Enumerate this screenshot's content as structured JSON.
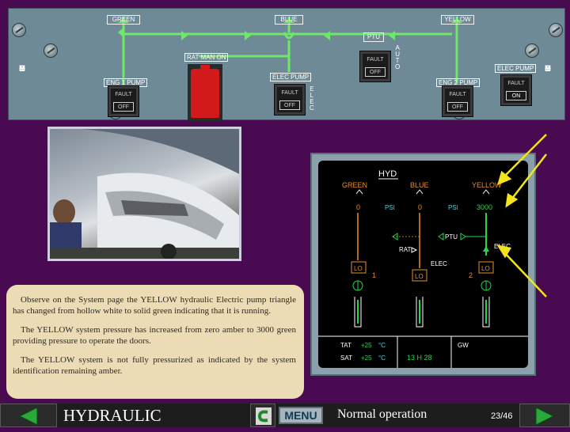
{
  "panel": {
    "side_left": [
      "H",
      "Y",
      "D"
    ],
    "side_right": [
      "H",
      "Y",
      "D"
    ],
    "systems": {
      "green": "GREEN",
      "blue": "BLUE",
      "yellow": "YELLOW"
    },
    "ptu_label": "PTU",
    "auto_label": [
      "A",
      "U",
      "T",
      "O"
    ],
    "ptu_button": {
      "top": "FAULT",
      "bottom": "OFF"
    },
    "rat_label": "RAT MAN ON",
    "elec_pump_blue_label": "ELEC PUMP",
    "elec_pump_blue_button": {
      "top": "FAULT",
      "bottom": "OFF"
    },
    "elec_vertical": [
      "E",
      "L",
      "E",
      "C"
    ],
    "eng1_label": "ENG 1 PUMP",
    "eng1_button": {
      "top": "FAULT",
      "bottom": "OFF"
    },
    "eng2_label": "ENG 2 PUMP",
    "eng2_button": {
      "top": "FAULT",
      "bottom": "OFF"
    },
    "elec_pump_yellow_label": "ELEC PUMP",
    "elec_pump_yellow_button": {
      "top": "FAULT",
      "bottom": "ON"
    }
  },
  "text_box": {
    "paragraphs": [
      "Observe on the System page the YELLOW hydraulic Electric pump triangle has changed from hollow white to solid green indicating that it is running.",
      "The YELLOW system pressure has increased from zero amber to 3000 green providing pressure to operate the doors.",
      "The YELLOW system is not fully pressurized as indicated by the system identification remaining amber."
    ]
  },
  "ecam": {
    "title": "HYD",
    "green": "GREEN",
    "blue": "BLUE",
    "yellow": "YELLOW",
    "green_psi_value": "0",
    "blue_psi_value": "0",
    "psi_left": "PSI",
    "psi_right": "PSI",
    "yellow_psi_value": "3000",
    "ptu": "PTU",
    "rat": "RAT",
    "elec_blue": "ELEC",
    "elec_yellow": "ELEC",
    "lo_label": "LO",
    "engine_1": "1",
    "engine_2": "2",
    "tat_label": "TAT",
    "tat_value": "+25",
    "tat_unit": "°C",
    "sat_label": "SAT",
    "sat_value": "+25",
    "sat_unit": "°C",
    "time": "13 H 28",
    "gw_label": "GW",
    "colors": {
      "amber": "#e8902a",
      "green": "#22d84b",
      "white": "#ffffff",
      "cyan": "#3fd5e8",
      "line_green": "#7ad868"
    }
  },
  "bottom_bar": {
    "course_title": "HYDRAULIC",
    "menu_label": "MENU",
    "screen_title": "Normal operation",
    "page_counter": "23/46"
  },
  "icons": [
    "back-arrow-icon",
    "next-arrow-icon",
    "return-icon",
    "pump-triangle-icon",
    "annotation-arrow-icon"
  ]
}
